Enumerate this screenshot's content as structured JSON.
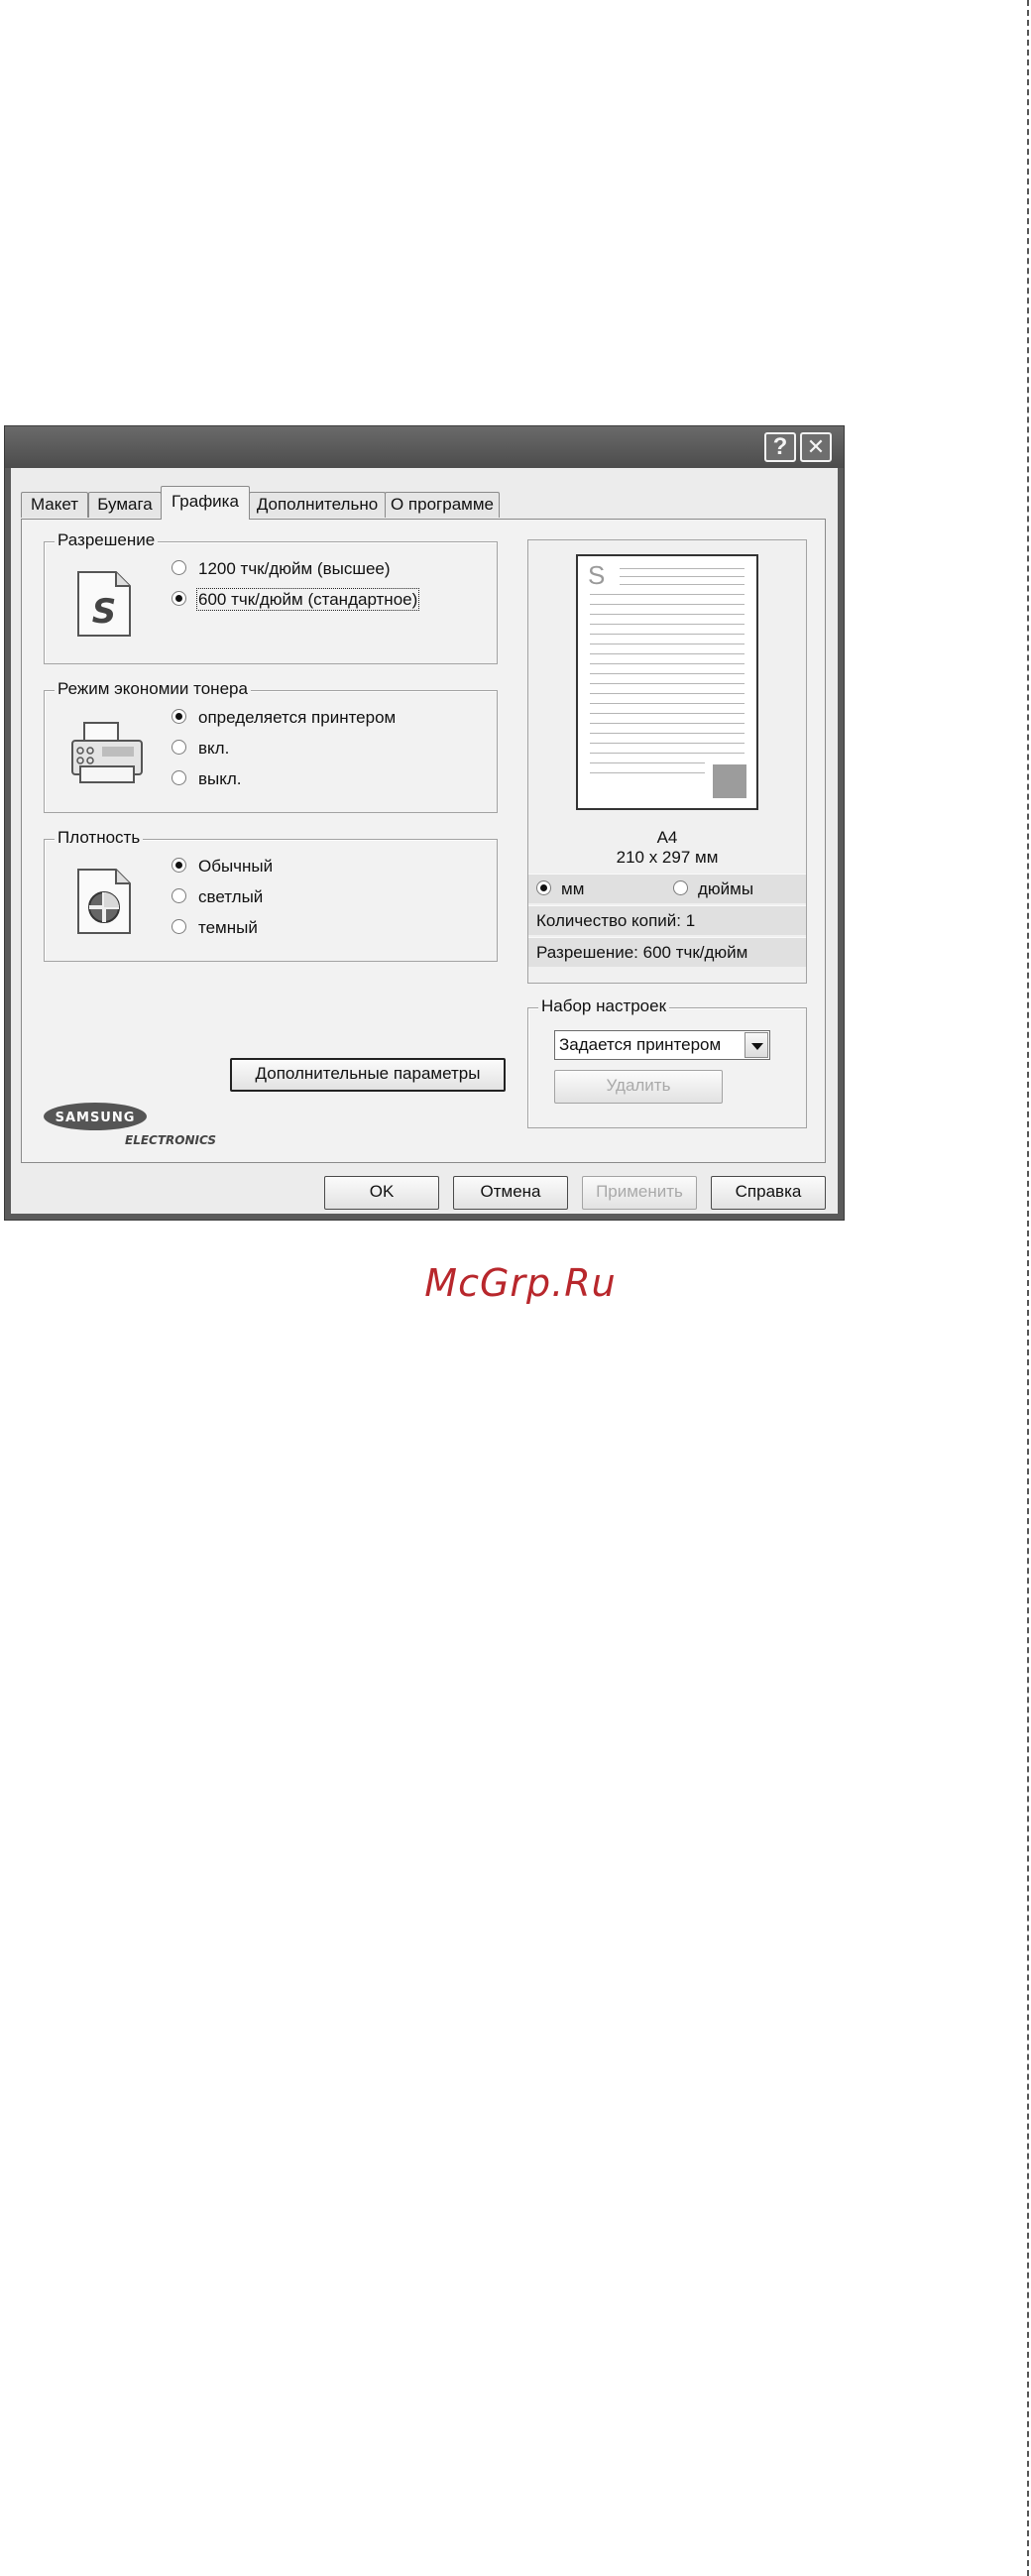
{
  "window": {
    "help_button": "?",
    "close_button": "✕"
  },
  "tabs": [
    {
      "label": "Макет"
    },
    {
      "label": "Бумага"
    },
    {
      "label": "Графика",
      "active": true
    },
    {
      "label": "Дополнительно"
    },
    {
      "label": "О программе"
    }
  ],
  "resolution": {
    "legend": "Разрешение",
    "options": [
      {
        "label": "1200 тчк/дюйм (высшее)",
        "selected": false
      },
      {
        "label": "600 тчк/дюйм (стандартное)",
        "selected": true
      }
    ]
  },
  "toner_save": {
    "legend": "Режим экономии тонера",
    "options": [
      {
        "label": "определяется принтером",
        "selected": true
      },
      {
        "label": "вкл.",
        "selected": false
      },
      {
        "label": "выкл.",
        "selected": false
      }
    ]
  },
  "density": {
    "legend": "Плотность",
    "options": [
      {
        "label": "Обычный",
        "selected": true
      },
      {
        "label": "светлый",
        "selected": false
      },
      {
        "label": "темный",
        "selected": false
      }
    ]
  },
  "advanced_button": "Дополнительные параметры",
  "logo": {
    "brand": "SAMSUNG",
    "sub": "ELECTRONICS"
  },
  "preview": {
    "page_letter": "S",
    "paper_name": "A4",
    "paper_size": "210 x 297 мм",
    "unit_mm": "мм",
    "unit_inch": "дюймы",
    "unit_selected": "мм",
    "copies": "Количество копий: 1",
    "resolution": "Разрешение: 600 тчк/дюйм"
  },
  "presets": {
    "legend": "Набор настроек",
    "selected": "Задается принтером",
    "delete_button": "Удалить"
  },
  "footer": {
    "ok": "OK",
    "cancel": "Отмена",
    "apply": "Применить",
    "help": "Справка"
  },
  "watermark": "McGrp.Ru"
}
